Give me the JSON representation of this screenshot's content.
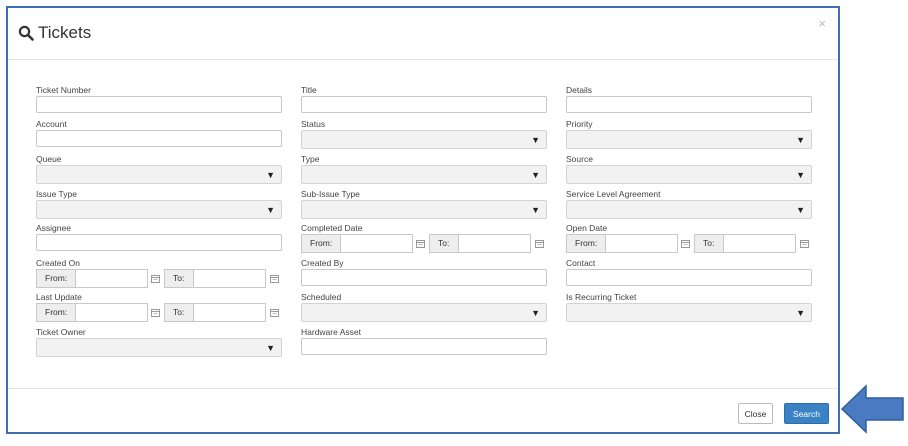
{
  "modal": {
    "title": "Tickets",
    "title_icon": "search-icon",
    "close_glyph": "×"
  },
  "fields": {
    "ticket_number": {
      "label": "Ticket Number",
      "value": ""
    },
    "title": {
      "label": "Title",
      "value": ""
    },
    "details": {
      "label": "Details",
      "value": ""
    },
    "account": {
      "label": "Account",
      "value": ""
    },
    "status": {
      "label": "Status",
      "selected": ""
    },
    "priority": {
      "label": "Priority",
      "selected": ""
    },
    "queue": {
      "label": "Queue",
      "selected": ""
    },
    "type": {
      "label": "Type",
      "selected": ""
    },
    "source": {
      "label": "Source",
      "selected": ""
    },
    "issue_type": {
      "label": "Issue Type",
      "selected": ""
    },
    "sub_issue_type": {
      "label": "Sub-Issue Type",
      "selected": ""
    },
    "sla": {
      "label": "Service Level Agreement",
      "selected": ""
    },
    "assignee": {
      "label": "Assignee",
      "value": ""
    },
    "completed_date": {
      "label": "Completed Date",
      "from_label": "From:",
      "to_label": "To:"
    },
    "open_date": {
      "label": "Open Date",
      "from_label": "From:",
      "to_label": "To:"
    },
    "created_on": {
      "label": "Created On",
      "from_label": "From:",
      "to_label": "To:"
    },
    "created_by": {
      "label": "Created By",
      "value": ""
    },
    "contact": {
      "label": "Contact",
      "value": ""
    },
    "last_update": {
      "label": "Last Update",
      "from_label": "From:",
      "to_label": "To:"
    },
    "scheduled": {
      "label": "Scheduled",
      "selected": ""
    },
    "is_recurring": {
      "label": "Is Recurring Ticket",
      "selected": ""
    },
    "ticket_owner": {
      "label": "Ticket Owner",
      "selected": ""
    },
    "hardware_asset": {
      "label": "Hardware Asset",
      "value": ""
    }
  },
  "dropdown_caret": "▼",
  "footer": {
    "close_label": "Close",
    "search_label": "Search"
  },
  "colors": {
    "modal_border": "#3f6fb0",
    "primary_button": "#3b82c4",
    "arrow_fill": "#4a7bc2"
  }
}
